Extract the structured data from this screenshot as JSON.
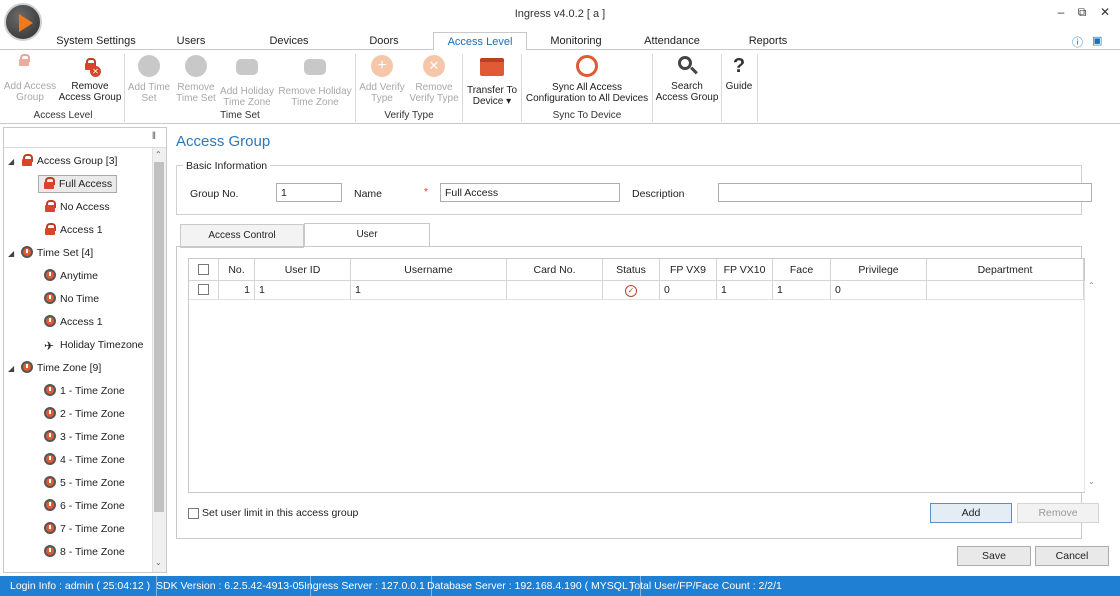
{
  "window": {
    "title": "Ingress v4.0.2 [ a ]",
    "controls": [
      "minimize-icon",
      "restore-icon",
      "close-icon"
    ]
  },
  "menu_tabs": [
    "System Settings",
    "Users",
    "Devices",
    "Doors",
    "Access Level",
    "Monitoring",
    "Attendance",
    "Reports"
  ],
  "menu_active": "Access Level",
  "ribbon": {
    "add_access_group": "Add Access Group",
    "remove_access_group": "Remove Access Group",
    "group_access_level": "Access Level",
    "add_time_set": "Add Time Set",
    "remove_time_set": "Remove Time Set",
    "add_holiday_time_zone": "Add Holiday Time Zone",
    "remove_holiday_time_zone": "Remove Holiday Time Zone",
    "group_time_set": "Time Set",
    "add_verify_type": "Add Verify Type",
    "remove_verify_type": "Remove Verify Type",
    "group_verify_type": "Verify Type",
    "transfer_to_device": "Transfer To Device",
    "sync_all": "Sync All Access Configuration to All Devices",
    "group_sync": "Sync To Device",
    "search_access_group": "Search Access Group",
    "guide": "Guide"
  },
  "tree": {
    "access_group": "Access Group [3]",
    "access_group_items": [
      "Full Access",
      "No Access",
      "Access 1"
    ],
    "time_set": "Time Set [4]",
    "time_set_items": [
      "Anytime",
      "No Time",
      "Access 1",
      "Holiday Timezone"
    ],
    "time_zone": "Time Zone [9]",
    "time_zone_items": [
      "1 - Time Zone",
      "2 - Time Zone",
      "3 - Time Zone",
      "4 - Time Zone",
      "5 - Time Zone",
      "6 - Time Zone",
      "7 - Time Zone",
      "8 - Time Zone"
    ]
  },
  "main": {
    "title": "Access Group",
    "basic_info": "Basic Information",
    "group_no_label": "Group No.",
    "group_no_value": "1",
    "name_label": "Name",
    "required_mark": "*",
    "name_value": "Full Access",
    "description_label": "Description",
    "description_value": "",
    "tabs": [
      "Access Control",
      "User"
    ],
    "active_tab": "User",
    "grid_headers": [
      "No.",
      "User ID",
      "Username",
      "Card No.",
      "Status",
      "FP VX9",
      "FP VX10",
      "Face",
      "Privilege",
      "Department"
    ],
    "grid_rows": [
      {
        "no": "1",
        "user_id": "1",
        "username": "1",
        "card_no": "",
        "status": "check-circle-icon",
        "fp_vx9": "0",
        "fp_vx10": "1",
        "face": "1",
        "privilege": "0",
        "department": ""
      }
    ],
    "user_limit_label": "Set user limit in this access group",
    "add_label": "Add",
    "remove_label": "Remove",
    "save_label": "Save",
    "cancel_label": "Cancel"
  },
  "status_bar": {
    "login": "Login Info : admin ( 25:04:12 )",
    "sdk": "SDK Version : 6.2.5.42-4913-05",
    "ingress_server": "Ingress Server : 127.0.0.1",
    "db_server": "Database Server : 192.168.4.190 ( MYSQL )",
    "count": "Total User/FP/Face Count : 2/2/1"
  },
  "colors": {
    "accent": "#1e7fd3",
    "title_blue": "#2a78c0",
    "lock_red": "#d9442a",
    "tab_active": "#1a6fb5"
  }
}
